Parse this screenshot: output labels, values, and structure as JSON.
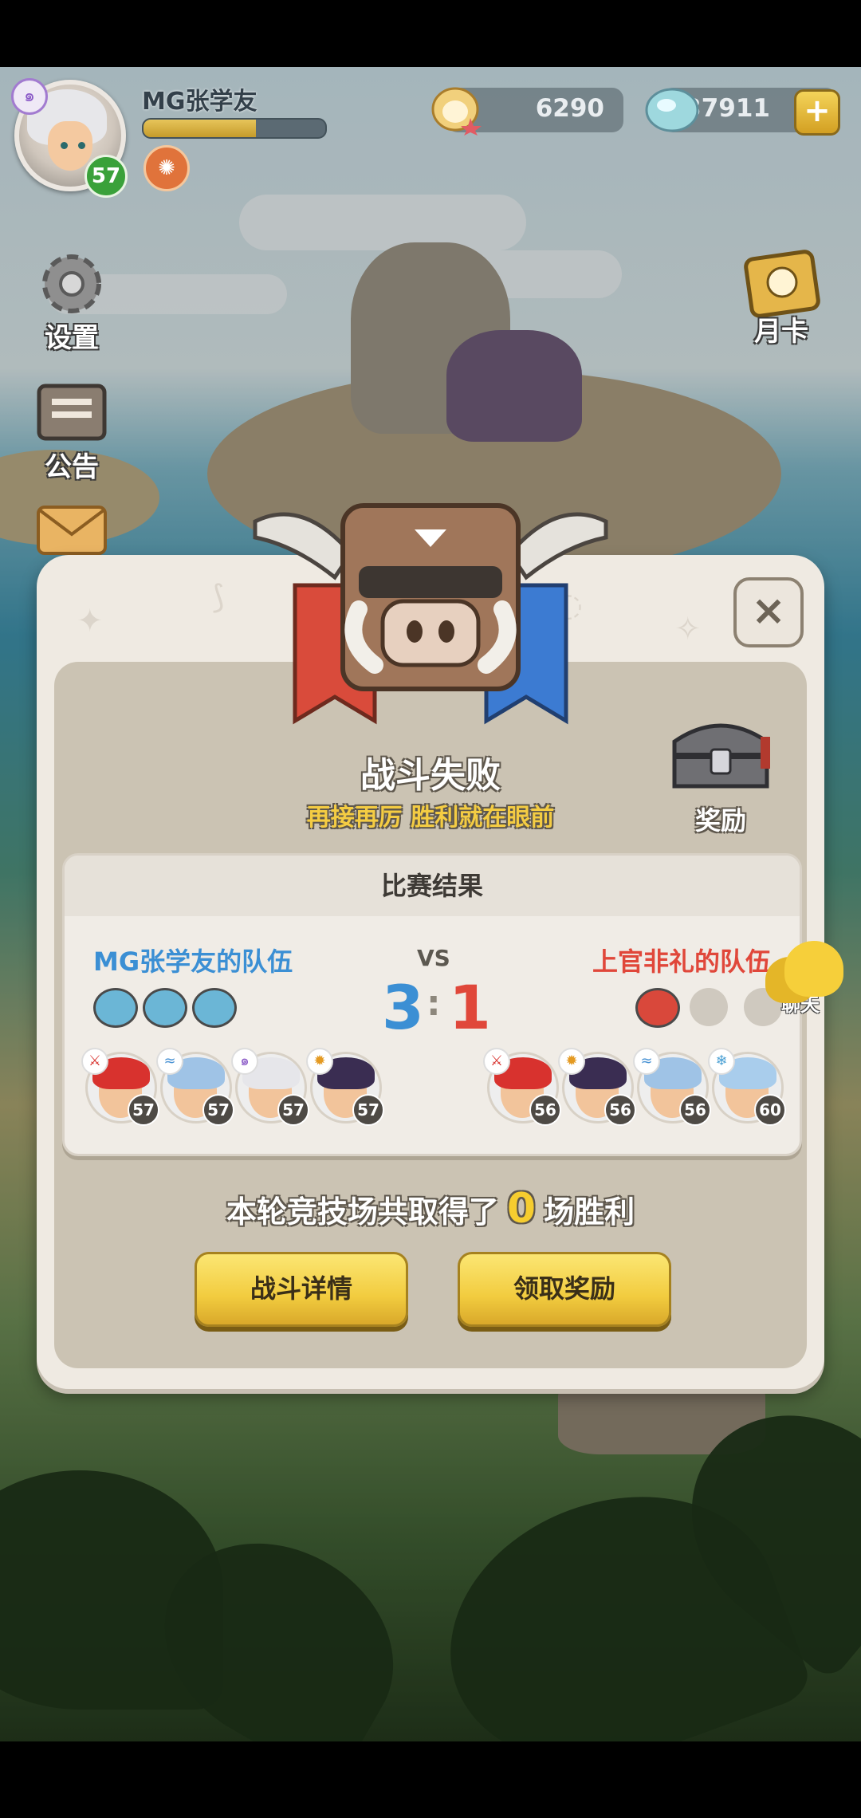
{
  "player": {
    "name": "MG张学友",
    "level": "57",
    "xp_progress": 0.62
  },
  "resources": {
    "coins": "6290",
    "gems": "37911"
  },
  "side_menu": {
    "settings": "设置",
    "notice": "公告",
    "monthly_card": "月卡"
  },
  "modal": {
    "title": "战斗失败",
    "subtitle": "再接再厉 胜利就在眼前",
    "reward_label": "奖励",
    "close_symbol": "×",
    "result": {
      "header": "比赛结果",
      "vs": "VS",
      "colon": ":",
      "left_team": {
        "name": "MG张学友的队伍",
        "score": "3",
        "wins": [
          true,
          true,
          true
        ]
      },
      "right_team": {
        "name": "上官非礼的队伍",
        "score": "1",
        "wins": [
          true,
          false,
          false
        ]
      },
      "left_heroes": [
        {
          "level": "57",
          "class_icon": "knight-icon"
        },
        {
          "level": "57",
          "class_icon": "water-icon"
        },
        {
          "level": "57",
          "class_icon": "spiral-icon"
        },
        {
          "level": "57",
          "class_icon": "fire-icon"
        }
      ],
      "right_heroes": [
        {
          "level": "56",
          "class_icon": "knight-icon"
        },
        {
          "level": "56",
          "class_icon": "fire-icon"
        },
        {
          "level": "56",
          "class_icon": "water-icon"
        },
        {
          "level": "60",
          "class_icon": "ice-icon"
        }
      ]
    },
    "summary_prefix": "本轮竞技场共取得了",
    "summary_count": "0",
    "summary_suffix": "场胜利",
    "battle_details_button": "战斗详情",
    "claim_reward_button": "领取奖励"
  },
  "chat_label": "聊天",
  "colors": {
    "team_left": "#3b8fd4",
    "team_right": "#e0473a",
    "button_yellow": "#f2cc3f"
  }
}
